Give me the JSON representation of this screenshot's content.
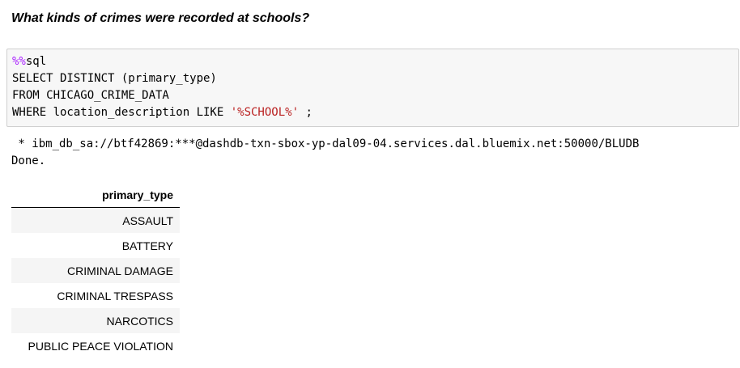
{
  "heading": "What kinds of crimes were recorded at schools?",
  "code": {
    "magic": "%%",
    "magic_rest": "sql",
    "line2": "SELECT DISTINCT (primary_type)",
    "line3": "FROM CHICAGO_CRIME_DATA",
    "line4_pre": "WHERE location_description LIKE ",
    "line4_str": "'%SCHOOL%'",
    "line4_post": " ;"
  },
  "output": {
    "connection": " * ibm_db_sa://btf42869:***@dashdb-txn-sbox-yp-dal09-04.services.dal.bluemix.net:50000/BLUDB",
    "status": "Done."
  },
  "table": {
    "header": "primary_type",
    "rows": [
      "ASSAULT",
      "BATTERY",
      "CRIMINAL DAMAGE",
      "CRIMINAL TRESPASS",
      "NARCOTICS",
      "PUBLIC PEACE VIOLATION"
    ]
  }
}
